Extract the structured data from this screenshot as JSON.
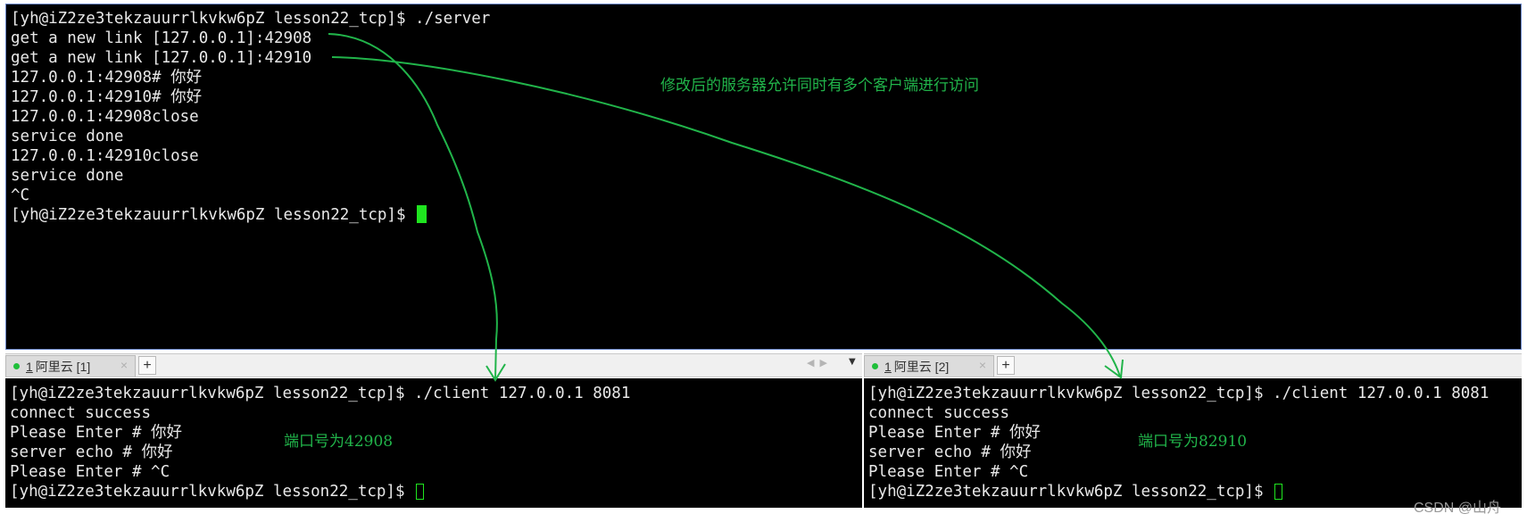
{
  "top_terminal": {
    "lines": [
      "[yh@iZ2ze3tekzauurrlkvkw6pZ lesson22_tcp]$ ./server",
      "get a new link [127.0.0.1]:42908",
      "get a new link [127.0.0.1]:42910",
      "127.0.0.1:42908# 你好",
      "127.0.0.1:42910# 你好",
      "127.0.0.1:42908close",
      "service done",
      "127.0.0.1:42910close",
      "service done",
      "^C"
    ],
    "prompt": "[yh@iZ2ze3tekzauurrlkvkw6pZ lesson22_tcp]$ "
  },
  "left_tabbar": {
    "tab_number": "1",
    "tab_label": " 阿里云 [1]",
    "close": "×",
    "plus": "+",
    "nav_left": "◀",
    "nav_right": "▶",
    "dropdown": "▼"
  },
  "right_tabbar": {
    "tab_number": "1",
    "tab_label": " 阿里云 [2]",
    "close": "×",
    "plus": "+"
  },
  "left_terminal": {
    "lines": [
      "[yh@iZ2ze3tekzauurrlkvkw6pZ lesson22_tcp]$ ./client 127.0.0.1 8081",
      "connect success",
      "Please Enter # 你好",
      "server echo # 你好",
      "Please Enter # ^C"
    ],
    "prompt": "[yh@iZ2ze3tekzauurrlkvkw6pZ lesson22_tcp]$ "
  },
  "right_terminal": {
    "lines": [
      "[yh@iZ2ze3tekzauurrlkvkw6pZ lesson22_tcp]$ ./client 127.0.0.1 8081",
      "connect success",
      "Please Enter # 你好",
      "server echo # 你好",
      "Please Enter # ^C"
    ],
    "prompt": "[yh@iZ2ze3tekzauurrlkvkw6pZ lesson22_tcp]$ "
  },
  "annotations": {
    "main": "修改后的服务器允许同时有多个客户端进行访问",
    "left_port": "端口号为42908",
    "right_port": "端口号为82910"
  },
  "watermark": "CSDN @山舟",
  "colors": {
    "terminal_bg": "#000000",
    "terminal_fg": "#e8e8e8",
    "cursor": "#1fe51f",
    "annotation": "#21b44a",
    "tab_dot": "#1fbf3a"
  }
}
